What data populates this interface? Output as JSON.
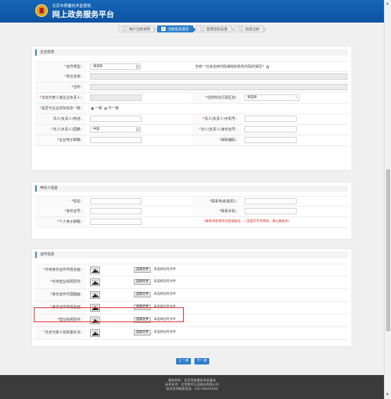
{
  "header": {
    "org_name": "北京市质量技术监督局",
    "platform_title": "网上政务服务平台"
  },
  "steps": [
    {
      "num": "1",
      "label": "用户注册说明"
    },
    {
      "num": "2",
      "label": "注册信息填写"
    },
    {
      "num": "3",
      "label": "登录密码设置"
    },
    {
      "num": "4",
      "label": "完成注册"
    }
  ],
  "enterprise": {
    "section_title": "企业信息",
    "cert_type_label": "证件类型：",
    "cert_type_value": "请选择",
    "no_credit_code_label": "无统一社会信用代码或组织机构代码的填写",
    "no_credit_code_suffix": "？",
    "unit_name_label": "单位名称：",
    "address_label": "住所：",
    "legal_rep_label": "法定代表人或企业负责人：",
    "district_label": "住所所在行政区划：",
    "district_value": "请选择",
    "consistent_label": "是否与企业实际信息一致：",
    "consistent_yes": "一致",
    "consistent_no": "不一致",
    "legal_phone_label": "法人(负责人)电话：",
    "legal_mobile_label": "法人(负责人)手机号：",
    "legal_nationality_label": "法人(负责人)国籍：",
    "legal_nationality_value": "中国",
    "legal_id_label": "法人(负责人)身份证号：",
    "email_label": "企业电子邮箱：",
    "postcode_label": "邮政编码："
  },
  "applicant": {
    "section_title": "申办人信息",
    "name_label": "姓名：",
    "contact_phone_label": "联系电话(座机)：",
    "id_label": "身份证号：",
    "mobile_label": "联系手机：",
    "email_label": "个人电子邮箱：",
    "mobile_note": "(联系手机将作为登录账号，一旦提交不可修改，请认真核对)"
  },
  "docs": {
    "section_title": "证件信息",
    "thumb_caption": "点击放大",
    "choose_btn": "选择文件",
    "no_file": "未选择任何文件",
    "items": [
      {
        "label": "手持身份证件件姓名面："
      },
      {
        "label": "手持营业执照原件："
      },
      {
        "label": "身份证件件国徽面："
      },
      {
        "label": "身份证件件姓名面："
      },
      {
        "label": "营业执照原件："
      },
      {
        "label": "法定代表人授权委托书："
      }
    ]
  },
  "buttons": {
    "prev": "上一步",
    "next": "下一步"
  },
  "footer": {
    "line1": "版权所有：北京市质量技术监督局",
    "line2": "技术支持：北京数字认证股份有限公司",
    "line3": "技术支持联系电话：010-58045600"
  },
  "colors": {
    "header_blue": "#1567b8",
    "step_active": "#2d7ec9",
    "required_star": "#d9261c",
    "highlight_box": "#e0262a"
  }
}
